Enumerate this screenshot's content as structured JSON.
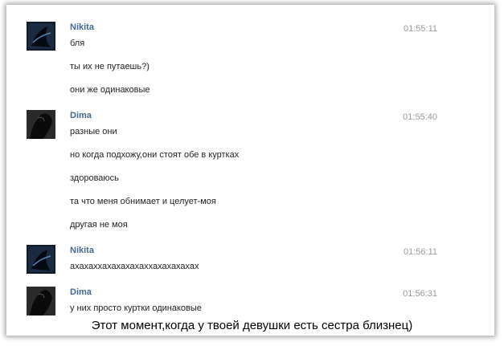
{
  "messages": [
    {
      "name": "Nikita",
      "time": "01:55:11",
      "lines": [
        "бля",
        "ты их не путаешь?)",
        "они же одинаковые"
      ]
    },
    {
      "name": "Dima",
      "time": "01:55:40",
      "lines": [
        "разные они",
        "но когда подхожу,они стоят обе в куртках",
        "здороваюсь",
        "та что меня обнимает и целует-моя",
        "другая не моя"
      ]
    },
    {
      "name": "Nikita",
      "time": "01:56:11",
      "lines": [
        "ахахаххахахахахаххахахахахах"
      ]
    },
    {
      "name": "Dima",
      "time": "01:56:31",
      "lines": [
        "у них просто куртки одинаковые"
      ]
    }
  ],
  "caption": "Этот момент,когда у твоей девушки есть сестра близнец)",
  "colors": {
    "name": "#45688e",
    "time": "#999999",
    "text": "#222222"
  }
}
